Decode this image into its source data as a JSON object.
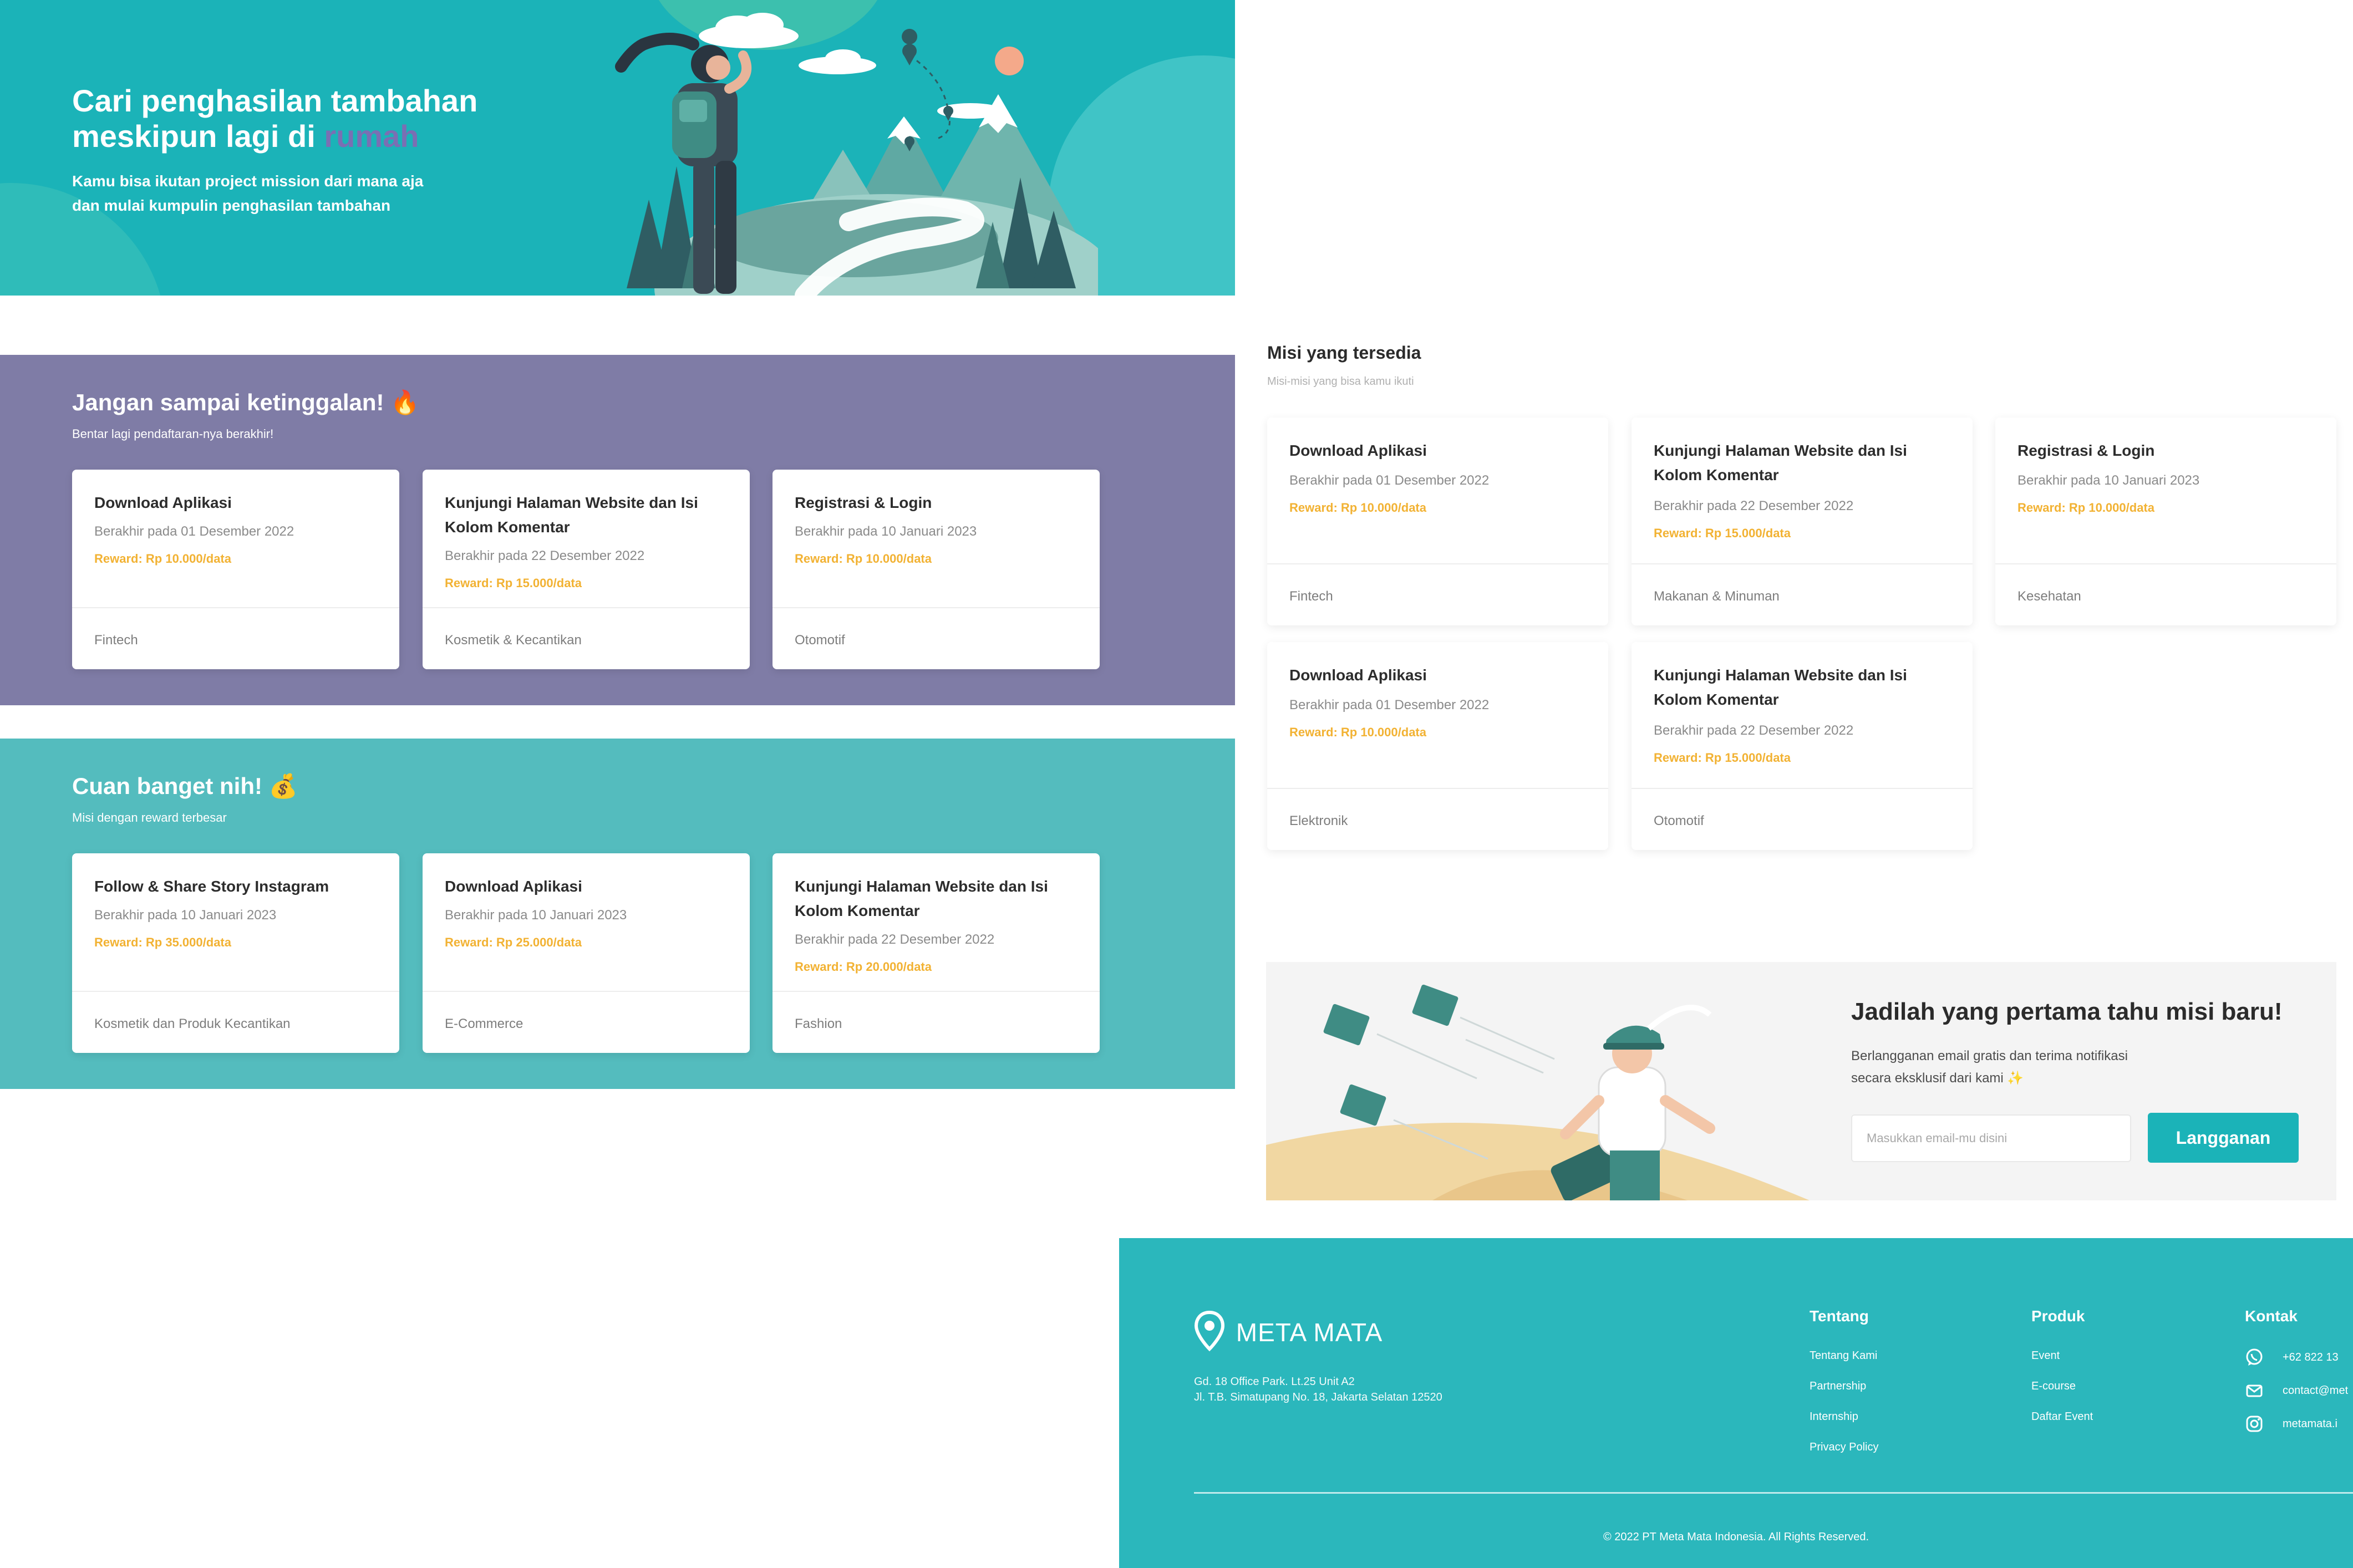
{
  "hero": {
    "title_line1": "Cari penghasilan tambahan",
    "title_line2_prefix": "meskipun lagi di",
    "title_accent": "rumah",
    "subtitle_line1": "Kamu bisa ikutan project mission dari mana aja",
    "subtitle_line2": "dan mulai kumpulin penghasilan tambahan",
    "illustration": "hiker-mountain-map-illustration"
  },
  "urgent": {
    "title": "Jangan sampai ketinggalan! 🔥",
    "subtitle": "Bentar lagi pendaftaran-nya berakhir!",
    "color": "#7f7ca6",
    "cards": [
      {
        "title": "Download Aplikasi",
        "deadline": "Berakhir pada 01 Desember 2022",
        "reward": "Reward: Rp 10.000/data",
        "category": "Fintech"
      },
      {
        "title": "Kunjungi Halaman Website dan Isi Kolom Komentar",
        "deadline": "Berakhir pada 22 Desember 2022",
        "reward": "Reward: Rp 15.000/data",
        "category": "Kosmetik & Kecantikan"
      },
      {
        "title": "Registrasi & Login",
        "deadline": "Berakhir pada 10 Januari 2023",
        "reward": "Reward: Rp 10.000/data",
        "category": "Otomotif"
      }
    ]
  },
  "cuan": {
    "title": "Cuan banget nih! 💰",
    "subtitle": "Misi dengan reward terbesar",
    "color": "#54bcbe",
    "cards": [
      {
        "title": "Follow & Share Story Instagram",
        "deadline": "Berakhir pada 10 Januari 2023",
        "reward": "Reward: Rp 35.000/data",
        "category": "Kosmetik dan Produk Kecantikan"
      },
      {
        "title": "Download Aplikasi",
        "deadline": "Berakhir pada 10 Januari 2023",
        "reward": "Reward: Rp 25.000/data",
        "category": "E-Commerce"
      },
      {
        "title": "Kunjungi Halaman Website dan Isi Kolom Komentar",
        "deadline": "Berakhir pada 22 Desember 2022",
        "reward": "Reward: Rp 20.000/data",
        "category": "Fashion"
      }
    ]
  },
  "available": {
    "title": "Misi yang tersedia",
    "subtitle": "Misi-misi yang bisa kamu ikuti",
    "cards": [
      {
        "title": "Download Aplikasi",
        "deadline": "Berakhir pada 01 Desember 2022",
        "reward": "Reward: Rp 10.000/data",
        "category": "Fintech"
      },
      {
        "title": "Kunjungi Halaman Website dan Isi Kolom Komentar",
        "deadline": "Berakhir pada 22 Desember 2022",
        "reward": "Reward: Rp 15.000/data",
        "category": "Makanan & Minuman"
      },
      {
        "title": "Registrasi & Login",
        "deadline": "Berakhir pada 10 Januari 2023",
        "reward": "Reward: Rp 10.000/data",
        "category": "Kesehatan"
      },
      {
        "title": "Download Aplikasi",
        "deadline": "Berakhir pada 01 Desember 2022",
        "reward": "Reward: Rp 10.000/data",
        "category": "Elektronik"
      },
      {
        "title": "Kunjungi Halaman Website dan Isi Kolom Komentar",
        "deadline": "Berakhir pada 22 Desember 2022",
        "reward": "Reward: Rp 15.000/data",
        "category": "Otomotif"
      }
    ]
  },
  "newsletter": {
    "title": "Jadilah yang pertama tahu misi baru!",
    "subtitle_line1": "Berlangganan email gratis dan terima notifikasi",
    "subtitle_line2": "secara eksklusif dari kami ✨",
    "placeholder": "Masukkan email-mu disini",
    "button": "Langganan"
  },
  "footer": {
    "brand": "META MATA",
    "address_line1": "Gd. 18 Office Park. Lt.25 Unit A2",
    "address_line2": "Jl. T.B. Simatupang No. 18, Jakarta Selatan 12520",
    "tentang": {
      "heading": "Tentang",
      "items": [
        "Tentang Kami",
        "Partnership",
        "Internship",
        "Privacy Policy"
      ]
    },
    "produk": {
      "heading": "Produk",
      "items": [
        "Event",
        "E-course",
        "Daftar Event"
      ]
    },
    "kontak": {
      "heading": "Kontak",
      "items": [
        "+62 822 13",
        "contact@met",
        "metamata.i"
      ]
    },
    "copyright": "© 2022 PT Meta Mata Indonesia. All Rights Reserved."
  }
}
